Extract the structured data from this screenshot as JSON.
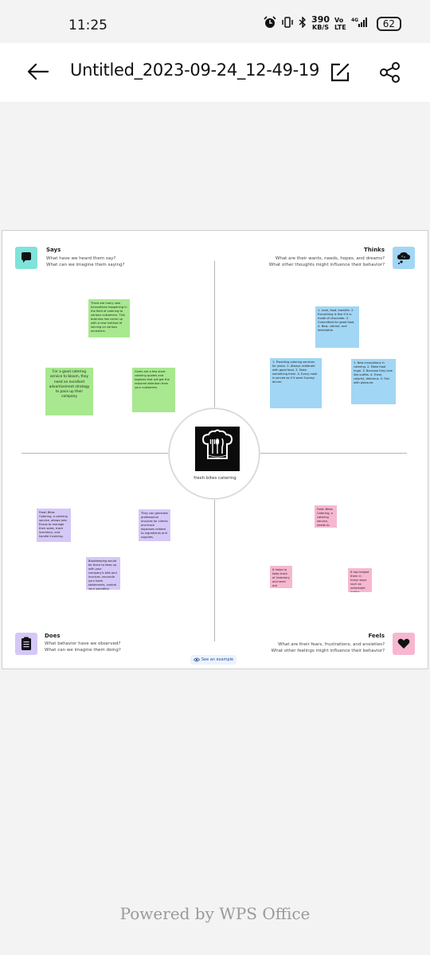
{
  "status": {
    "time": "11:25",
    "speed_value": "390",
    "speed_unit": "KB/S",
    "net_a": "Vo",
    "net_b": "LTE",
    "net_gen": "4G",
    "battery": "62"
  },
  "header": {
    "title": "Untitled_2023-09-24_12-49-19"
  },
  "map": {
    "says": {
      "title": "Says",
      "line1": "What have we heard them say?",
      "line2": "What can we imagine them saying?"
    },
    "thinks": {
      "title": "Thinks",
      "line1": "What are their wants, needs, hopes, and dreams?",
      "line2": "What other thoughts might influence their behavior?"
    },
    "does": {
      "title": "Does",
      "line1": "What behavior have we observed?",
      "line2": "What can we imagine them doing?"
    },
    "feels": {
      "title": "Feels",
      "line1": "What are their fears, frustrations, and anxieties?",
      "line2": "What other feelings might influence their behavior?"
    },
    "center_label": "fresh bites catering",
    "see_example": "See an example",
    "notes": {
      "says_1": "There are many new innovations happening in the field of catering to various customers. This business has come up with a new method of serving on various occasions.",
      "says_2": "For a good catering service to bloom, they need an excellent advertisement strategy to pace up their company",
      "says_3": "Given are a few short catering quotes and taglines that will get the required attention from your customers.",
      "thinks_1": "1. Love, food, lowstills. 2. Everything is fine if it is made of chocolate. 3. Committed for good food. 4. New, vibrant, and delectable.",
      "thinks_2": "1. Providing catering services for years. 2. Always celebrate with good food. 3. Taste something fresh. 4. Every meal is served as if it were Sunday dinner.",
      "thinks_3": "1. New innovations in catering. 2. Make food huge. 3. Because they look like outfits. 4. Fresh, colorful, delicious. 5. Fed with pleasure.",
      "does_1": "Fresh Bites Catering, a catering service, allows John Evans to manage their sales, track inventory, and handle invoicing.",
      "does_2": "They can generate professional invoices for clients and track expenses related to ingredients and supplies.",
      "does_3": "Bookkeeping would be there to keep up with your company's bills and invoices, reconcile your bank statements, control your spending, oversee projects, and eliminate DIY bookkeeping mistakes.",
      "feels_1": "Fresh Bites Catering, a catering service, needs to manage its sales, track its inventory, and handle invoicing.",
      "feels_2": "It helps to keep track of inventory and send out professional invoices to their customers.",
      "feels_3": "It has helped them in many ways such as scheduled orders, automated reports, delivery management."
    }
  },
  "footer": {
    "powered_by": "Powered by WPS Office"
  },
  "colors": {
    "says": "#7fe3d9",
    "thinks": "#a2d6f5",
    "does": "#d5c7f7",
    "feels": "#f7b7d0"
  }
}
